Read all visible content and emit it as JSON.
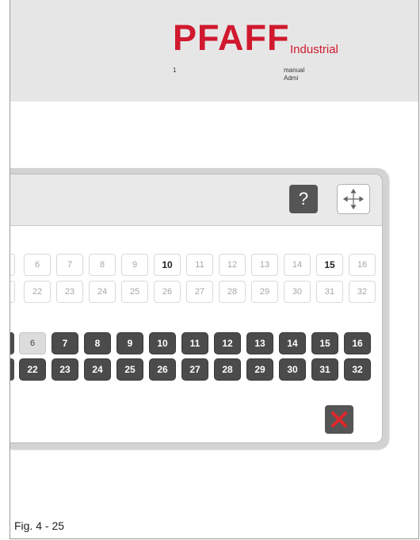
{
  "header": {
    "brand": "PFAFF",
    "brand_sub": "Industrial",
    "number": "1",
    "mode": "manual",
    "user": "Admi"
  },
  "dialog": {
    "help_label": "?",
    "row1": [
      "6",
      "7",
      "8",
      "9",
      "10",
      "11",
      "12",
      "13",
      "14",
      "15",
      "16"
    ],
    "row2": [
      "22",
      "23",
      "24",
      "25",
      "26",
      "27",
      "28",
      "29",
      "30",
      "31",
      "32"
    ],
    "row3": [
      "6",
      "7",
      "8",
      "9",
      "10",
      "11",
      "12",
      "13",
      "14",
      "15",
      "16"
    ],
    "row4": [
      "22",
      "23",
      "24",
      "25",
      "26",
      "27",
      "28",
      "29",
      "30",
      "31",
      "32"
    ]
  },
  "caption": "Fig. 4 - 25",
  "colors": {
    "brand": "#d0192e",
    "button": "#4b4b4b",
    "close_x": "#e0262c"
  }
}
